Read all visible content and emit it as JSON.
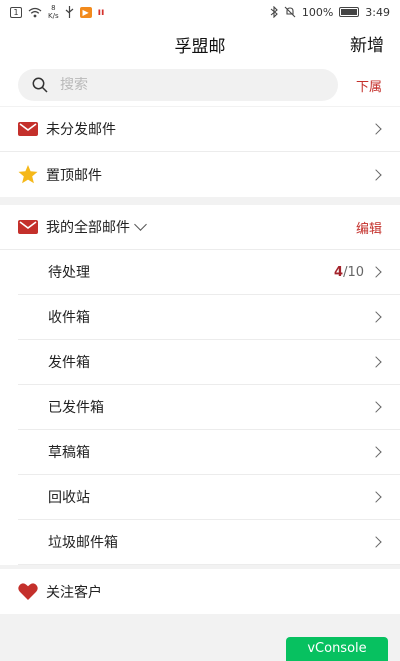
{
  "status_bar": {
    "speed_value": "8",
    "speed_unit": "K/s",
    "battery": "100%",
    "time": "3:49"
  },
  "header": {
    "title": "孚盟邮",
    "new_label": "新增"
  },
  "search": {
    "placeholder": "搜索",
    "subordinate_label": "下属"
  },
  "quick_items": [
    {
      "label": "未分发邮件",
      "icon": "red-mail-icon"
    },
    {
      "label": "置顶邮件",
      "icon": "star-icon"
    }
  ],
  "all_mail": {
    "label": "我的全部邮件",
    "edit_label": "编辑",
    "folders": [
      {
        "label": "待处理",
        "count_current": "4",
        "count_total": "/10"
      },
      {
        "label": "收件箱"
      },
      {
        "label": "发件箱"
      },
      {
        "label": "已发件箱"
      },
      {
        "label": "草稿箱"
      },
      {
        "label": "回收站"
      },
      {
        "label": "垃圾邮件箱"
      }
    ]
  },
  "followed": {
    "label": "关注客户",
    "icon": "heart-icon"
  },
  "vconsole": {
    "label": "vConsole"
  },
  "colors": {
    "accent": "#c4302b",
    "count_highlight": "#a3232b",
    "vconsole": "#07c160"
  }
}
